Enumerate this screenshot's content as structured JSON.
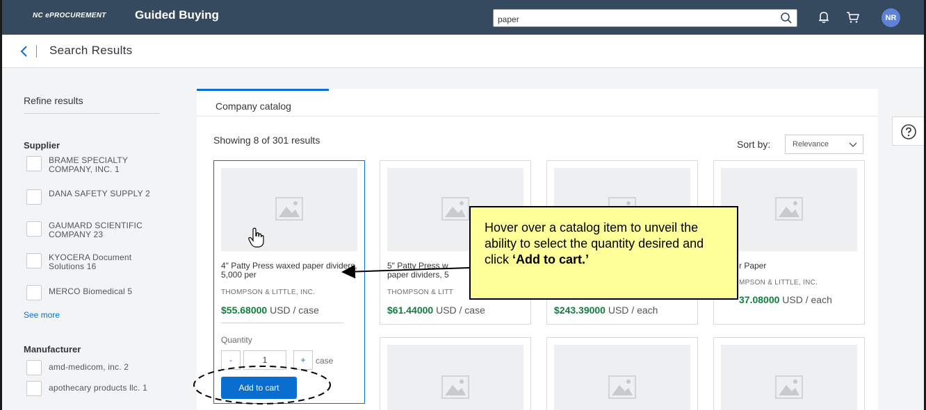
{
  "header": {
    "brand_small": "NC ePROCUREMENT",
    "brand_title": "Guided Buying",
    "search_value": "paper",
    "avatar_initials": "NR",
    "icons": [
      "search-icon",
      "bell-icon",
      "cart-icon"
    ],
    "bar_color": "#354a5f"
  },
  "subheader": {
    "title": "Search Results"
  },
  "sidebar": {
    "refine_title": "Refine results",
    "supplier": {
      "title": "Supplier",
      "items": [
        {
          "label": "BRAME SPECIALTY COMPANY, INC.  1"
        },
        {
          "label": "DANA SAFETY SUPPLY  2"
        },
        {
          "label": "GAUMARD SCIENTIFIC COMPANY  23"
        },
        {
          "label": "KYOCERA Document Solutions  16"
        },
        {
          "label": "MERCO Biomedical  5"
        }
      ],
      "see_more": "See more"
    },
    "manufacturer": {
      "title": "Manufacturer",
      "items": [
        {
          "label": "amd-medicom, inc.  2"
        },
        {
          "label": "apothecary products llc.  1"
        }
      ]
    }
  },
  "tabs": [
    {
      "label": "Company catalog",
      "active": true
    }
  ],
  "results": {
    "count_text": "Showing 8 of 301 results",
    "sort_label": "Sort by:",
    "sort_value": "Relevance"
  },
  "cards": [
    {
      "name": "4\" Patty Press waxed paper dividers, 5,000 per",
      "supplier": "THOMPSON & LITTLE, INC.",
      "price": "$55.68000",
      "unit": "USD / case",
      "quantity_label": "Quantity",
      "minus": "-",
      "plus": "+",
      "quantity": "1",
      "qty_unit": "case",
      "add_label": "Add to cart"
    },
    {
      "name": "5\" Patty Press w paper dividers, 5",
      "supplier": "THOMPSON & LITT",
      "price": "$61.44000",
      "unit": "USD / case"
    },
    {
      "name": "",
      "supplier": "",
      "price": "$243.39000",
      "unit": "USD / each"
    },
    {
      "name": "r Paper",
      "supplier": "MPSON & LITTLE, INC.",
      "price": "37.08000",
      "unit": "USD / each"
    }
  ],
  "callout": {
    "text_plain": "Hover over a catalog item to unveil the ability to select the quantity desired and click ",
    "text_bold": "‘Add to cart.’",
    "bg_color": "#ffff99"
  },
  "help_icon": "help-icon",
  "accent_color": "#0a6ed1",
  "price_color": "#107e3e"
}
